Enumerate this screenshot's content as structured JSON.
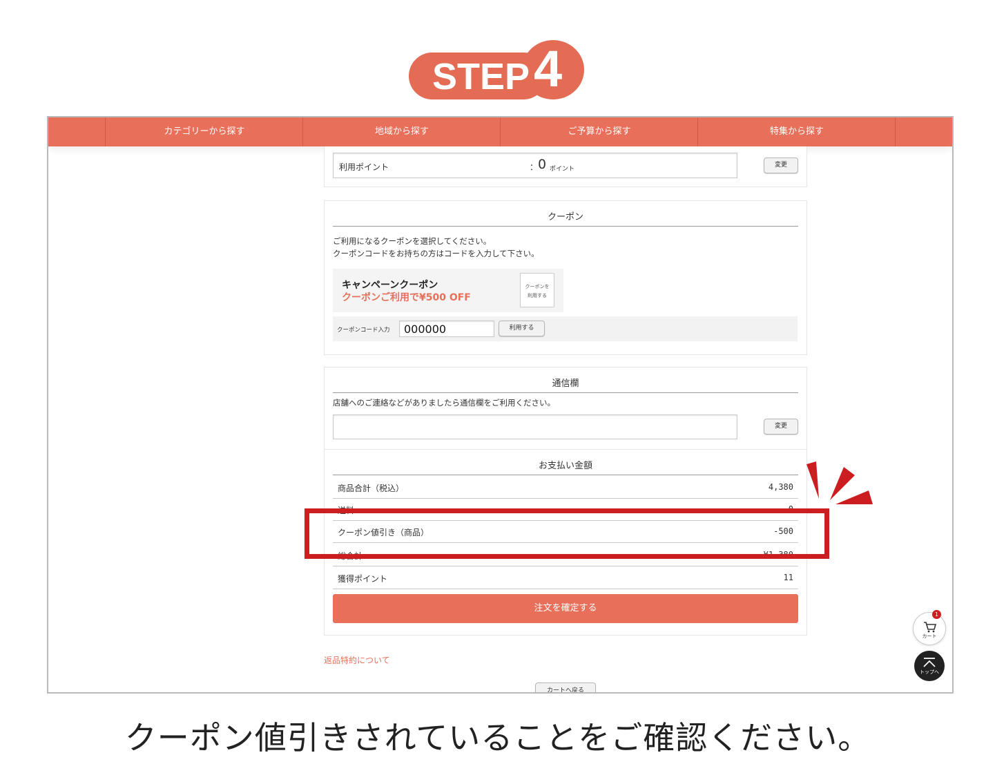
{
  "step": {
    "label": "STEP",
    "number": "4"
  },
  "nav": {
    "items": [
      "カテゴリーから探す",
      "地域から探す",
      "ご予算から探す",
      "特集から探す"
    ]
  },
  "points": {
    "label": "利用ポイント",
    "colon": "：",
    "value": "0",
    "unit": "ポイント",
    "change_button": "変更"
  },
  "coupon": {
    "title": "クーポン",
    "desc1": "ご利用になるクーポンを選択してください。",
    "desc2": "クーポンコードをお持ちの方はコードを入力して下さい。",
    "campaign_title": "キャンペーンクーポン",
    "campaign_offer": "クーポンご利用で¥500 OFF",
    "use_coupon_button_line1": "クーポンを",
    "use_coupon_button_line2": "利用する",
    "code_label": "クーポンコード入力",
    "code_value": "000000",
    "apply_button": "利用する"
  },
  "message": {
    "title": "通信欄",
    "desc": "店舗へのご連絡などがありましたら通信欄をご利用ください。",
    "change_button": "変更"
  },
  "payment": {
    "title": "お支払い金額",
    "rows": [
      {
        "label": "商品合計（税込）",
        "value": "4,380"
      },
      {
        "label": "送料",
        "value": "0"
      },
      {
        "label": "クーポン値引き（商品）",
        "value": "-500"
      },
      {
        "label": "総合計",
        "value": "¥1,380"
      },
      {
        "label": "獲得ポイント",
        "value": "11"
      }
    ],
    "confirm_button": "注文を確定する"
  },
  "return_policy_link": "返品特約について",
  "back_to_cart_button": "カートへ戻る",
  "floating": {
    "cart_label": "カート",
    "cart_badge": "1",
    "top_label": "トップへ"
  },
  "caption": "クーポン値引きされていることをご確認ください。",
  "colors": {
    "accent": "#e8705a",
    "highlight": "#cc1d21"
  }
}
